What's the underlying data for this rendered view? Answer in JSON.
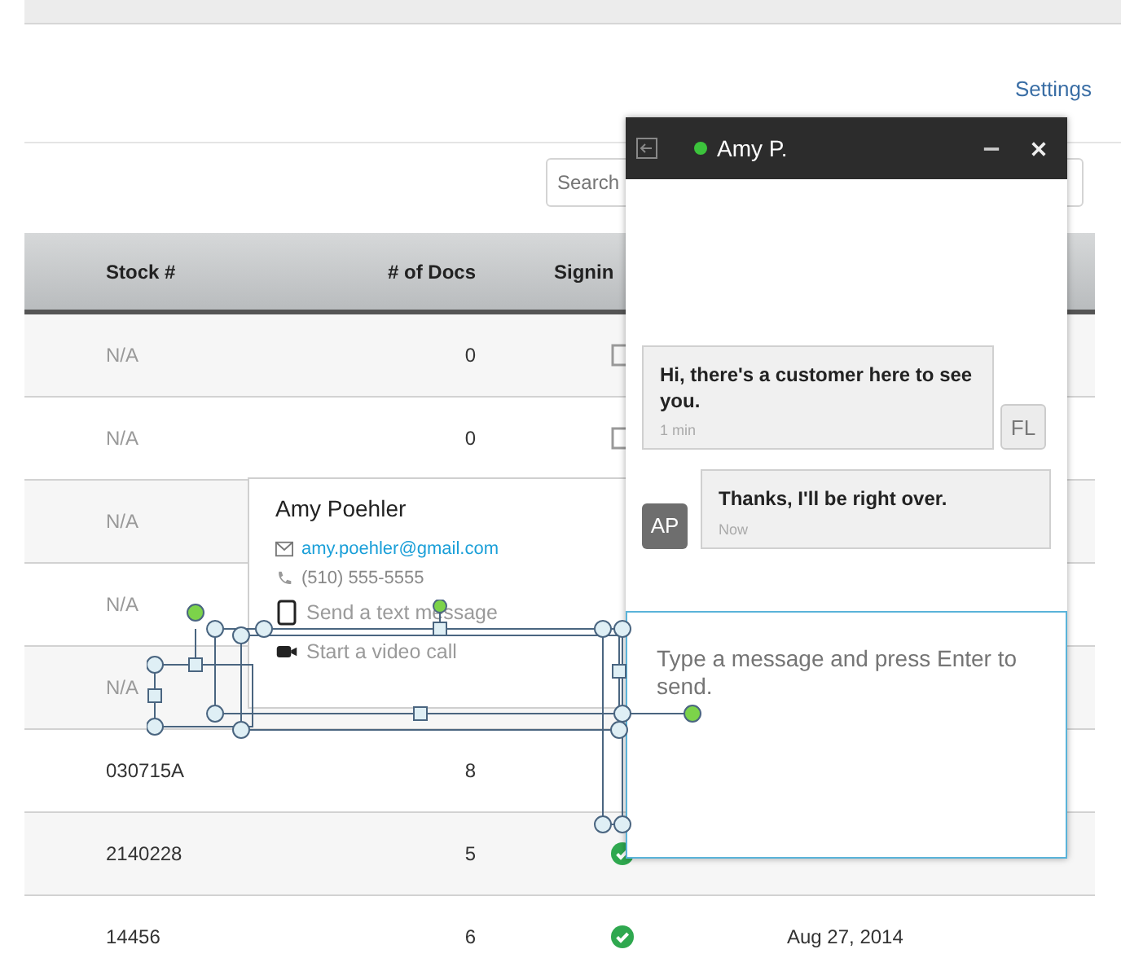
{
  "header": {
    "settings_link": "Settings"
  },
  "search": {
    "placeholder": "Search"
  },
  "table": {
    "columns": [
      "Stock #",
      "# of Docs",
      "Signin"
    ],
    "rows": [
      {
        "stock": "N/A",
        "docs": "0",
        "signed": false
      },
      {
        "stock": "N/A",
        "docs": "0",
        "signed": false
      },
      {
        "stock": "N/A"
      },
      {
        "stock": "N/A"
      },
      {
        "stock": "N/A"
      },
      {
        "stock": "030715A",
        "docs": "8"
      },
      {
        "stock": "2140228",
        "docs": "5",
        "signed": true
      },
      {
        "stock": "14456",
        "docs": "6",
        "signed": true,
        "date": "Aug 27, 2014"
      }
    ]
  },
  "contact_card": {
    "name": "Amy Poehler",
    "email": "amy.poehler@gmail.com",
    "phone": "(510) 555-5555",
    "actions": [
      {
        "kind": "text",
        "label": "Send a text message",
        "disabled": true
      },
      {
        "kind": "video",
        "label": "Start a video call",
        "disabled": true
      }
    ]
  },
  "chat": {
    "title": "Amy P.",
    "online": true,
    "messages": [
      {
        "text": "Hi, there's a customer here to see you.",
        "time": "1 min",
        "initials": "FL",
        "kind": "incoming"
      },
      {
        "text": "Thanks, I'll be right over.",
        "time": "Now",
        "initials": "AP",
        "kind": "outgoing"
      }
    ],
    "input": {
      "placeholder": "Type a message and press Enter to send."
    }
  }
}
